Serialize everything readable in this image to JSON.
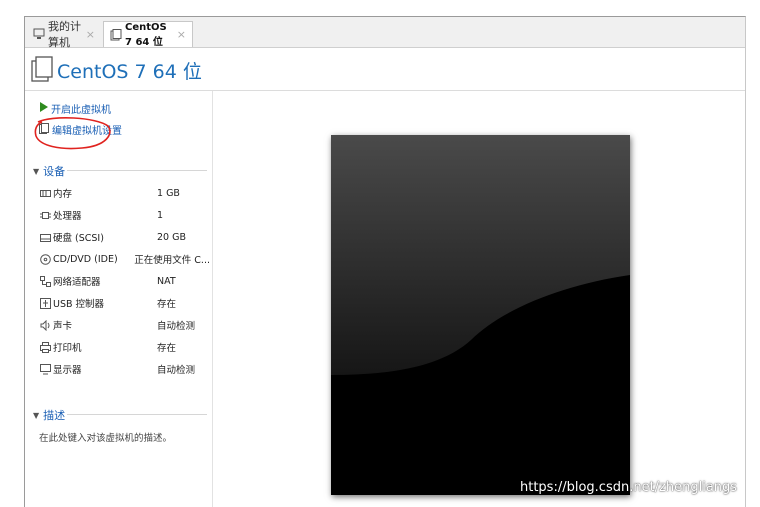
{
  "tabs": [
    {
      "label": "我的计算机",
      "close": "×",
      "active": false
    },
    {
      "label": "CentOS 7 64 位",
      "close": "×",
      "active": true
    }
  ],
  "vm": {
    "title": "CentOS 7 64 位"
  },
  "actions": {
    "power_on": "开启此虚拟机",
    "edit_settings": "编辑虚拟机设置"
  },
  "devices": {
    "heading": "设备",
    "items": [
      {
        "name": "内存",
        "value": "1 GB",
        "icon": "memory-icon"
      },
      {
        "name": "处理器",
        "value": "1",
        "icon": "processor-icon"
      },
      {
        "name": "硬盘 (SCSI)",
        "value": "20 GB",
        "icon": "hard-disk-icon"
      },
      {
        "name": "CD/DVD (IDE)",
        "value": "正在使用文件 C...",
        "icon": "cd-dvd-icon"
      },
      {
        "name": "网络适配器",
        "value": "NAT",
        "icon": "network-adapter-icon"
      },
      {
        "name": "USB 控制器",
        "value": "存在",
        "icon": "usb-controller-icon"
      },
      {
        "name": "声卡",
        "value": "自动检测",
        "icon": "sound-card-icon"
      },
      {
        "name": "打印机",
        "value": "存在",
        "icon": "printer-icon"
      },
      {
        "name": "显示器",
        "value": "自动检测",
        "icon": "display-icon"
      }
    ]
  },
  "description": {
    "heading": "描述",
    "placeholder": "在此处键入对该虚拟机的描述。"
  },
  "watermark": "https://blog.csdn.net/zhengliangs",
  "colors": {
    "link": "#1a5fb4",
    "title": "#1e6fb8",
    "annotation": "#e0231f",
    "play": "#2e8b1e"
  }
}
